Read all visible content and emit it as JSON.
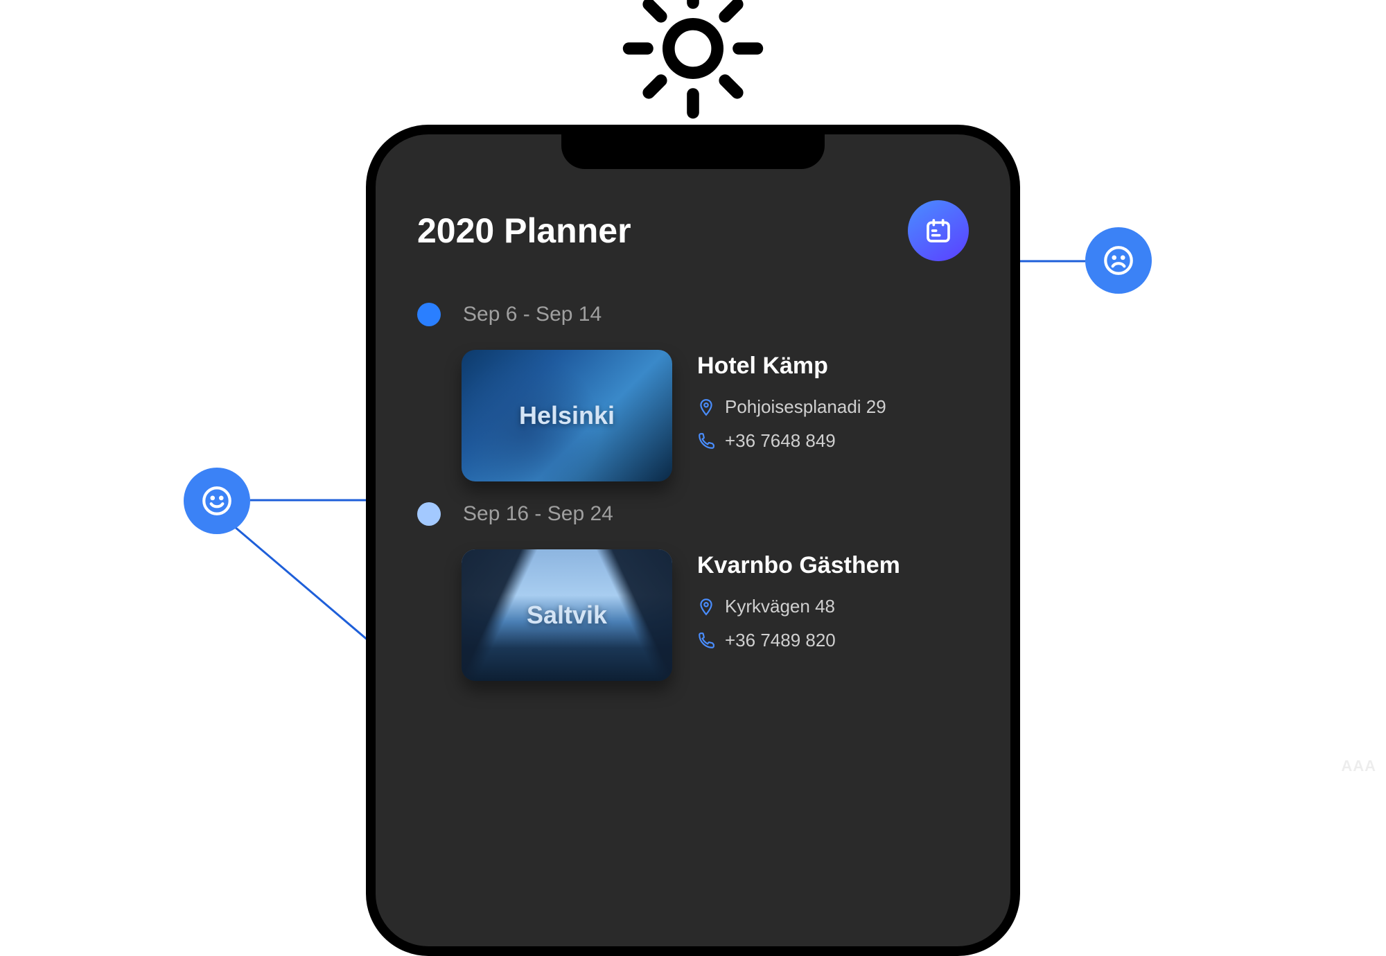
{
  "title": "2020 Planner",
  "trips": [
    {
      "dateRange": "Sep 6 - Sep 14",
      "cardLabel": "Helsinki",
      "hotelName": "Hotel Kämp",
      "address": "Pohjoisesplanadi 29",
      "phone": "+36 7648 849"
    },
    {
      "dateRange": "Sep 16 - Sep 24",
      "cardLabel": "Saltvik",
      "hotelName": "Kvarnbo Gästhem",
      "address": "Kyrkvägen 48",
      "phone": "+36 7489 820"
    }
  ],
  "watermark": "AAA"
}
